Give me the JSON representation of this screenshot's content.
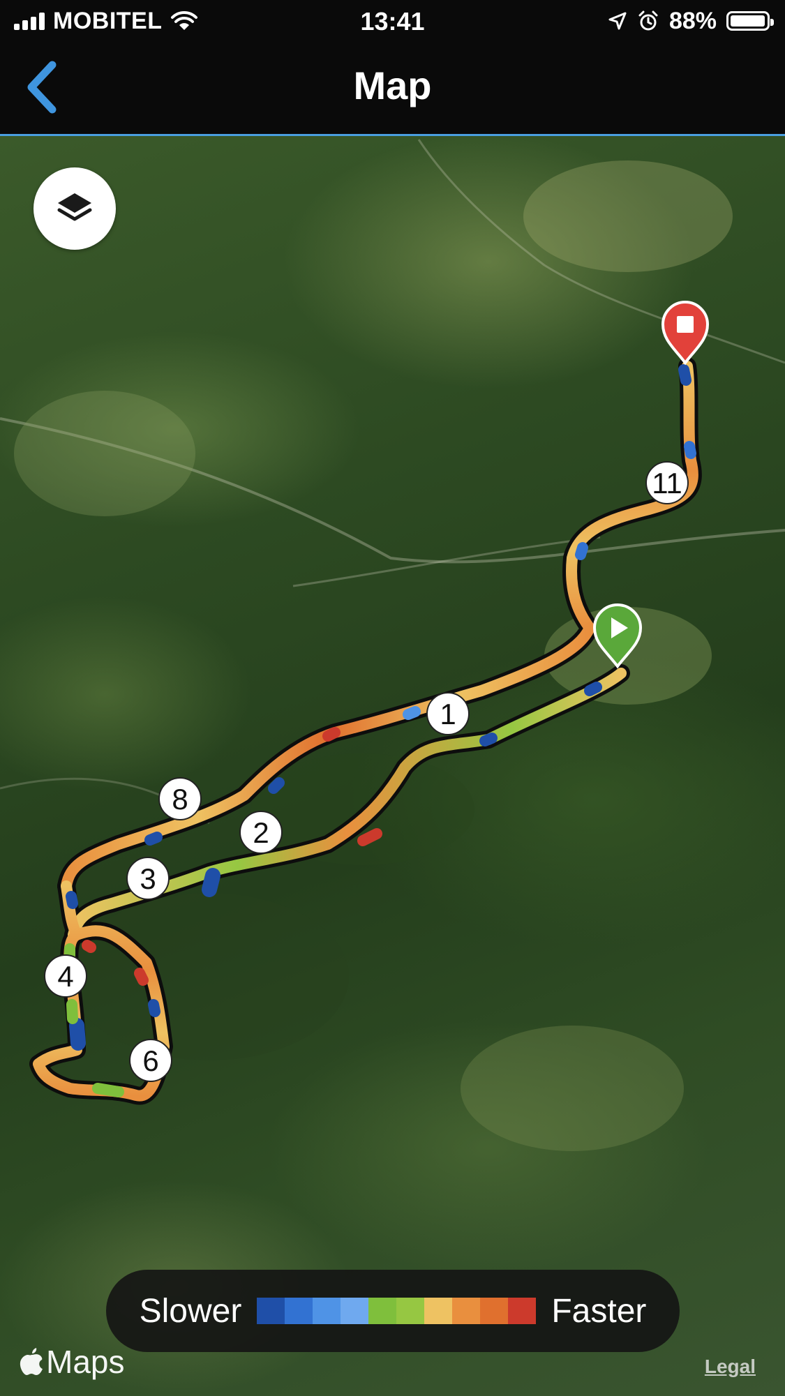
{
  "status_bar": {
    "carrier": "MOBITEL",
    "time": "13:41",
    "battery_percent": "88%"
  },
  "nav": {
    "title": "Map",
    "back_icon": "chevron-left-icon"
  },
  "map": {
    "layers_icon": "layers-icon",
    "start_icon": "play-icon",
    "finish_icon": "stop-icon",
    "lap_markers": [
      "1",
      "2",
      "3",
      "4",
      "6",
      "8",
      "11"
    ],
    "legend": {
      "slower_label": "Slower",
      "faster_label": "Faster",
      "colors": [
        "#1f4fa8",
        "#3272d2",
        "#4f93e6",
        "#6fa9ef",
        "#7fbf3c",
        "#96c742",
        "#eec262",
        "#e98f3e",
        "#e0702e",
        "#cc3a2c"
      ]
    },
    "attribution": "Maps",
    "legal_label": "Legal"
  }
}
